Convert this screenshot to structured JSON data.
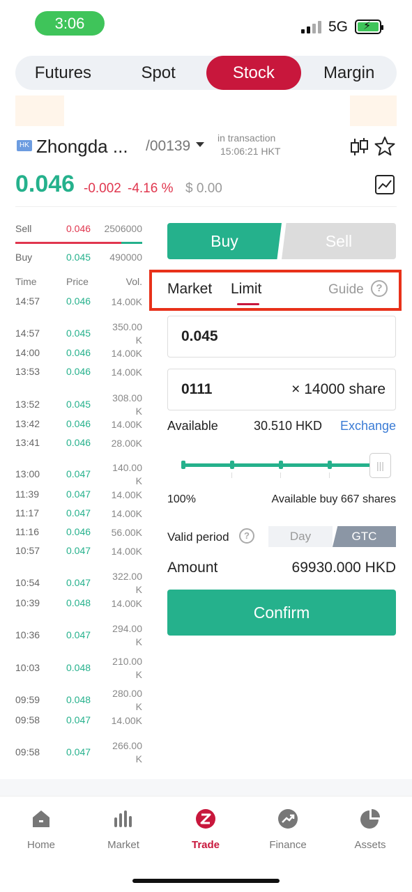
{
  "status_bar": {
    "time": "3:06",
    "network": "5G"
  },
  "top_tabs": [
    "Futures",
    "Spot",
    "Stock",
    "Margin"
  ],
  "stock": {
    "badge": "HK",
    "name": "Zhongda ...",
    "code": "/00139",
    "status": "in transaction",
    "status_time": "15:06:21 HKT",
    "last_price": "0.046",
    "change": "-0.002",
    "change_pct": "-4.16 %",
    "value": "$ 0.00"
  },
  "order_book": {
    "sell": {
      "label": "Sell",
      "price": "0.046",
      "volume": "2506000"
    },
    "buy": {
      "label": "Buy",
      "price": "0.045",
      "volume": "490000"
    }
  },
  "trades": {
    "headers": [
      "Time",
      "Price",
      "Vol."
    ],
    "rows": [
      {
        "time": "14:57",
        "price": "0.046",
        "vol": "14.00K"
      },
      {
        "time": "14:57",
        "price": "0.045",
        "vol": "350.00 K"
      },
      {
        "time": "14:00",
        "price": "0.046",
        "vol": "14.00K"
      },
      {
        "time": "13:53",
        "price": "0.046",
        "vol": "14.00K"
      },
      {
        "time": "13:52",
        "price": "0.045",
        "vol": "308.00 K"
      },
      {
        "time": "13:42",
        "price": "0.046",
        "vol": "14.00K"
      },
      {
        "time": "13:41",
        "price": "0.046",
        "vol": "28.00K"
      },
      {
        "time": "13:00",
        "price": "0.047",
        "vol": "140.00 K"
      },
      {
        "time": "11:39",
        "price": "0.047",
        "vol": "14.00K"
      },
      {
        "time": "11:17",
        "price": "0.047",
        "vol": "14.00K"
      },
      {
        "time": "11:16",
        "price": "0.046",
        "vol": "56.00K"
      },
      {
        "time": "10:57",
        "price": "0.047",
        "vol": "14.00K"
      },
      {
        "time": "10:54",
        "price": "0.047",
        "vol": "322.00 K"
      },
      {
        "time": "10:39",
        "price": "0.048",
        "vol": "14.00K"
      },
      {
        "time": "10:36",
        "price": "0.047",
        "vol": "294.00 K"
      },
      {
        "time": "10:03",
        "price": "0.048",
        "vol": "210.00 K"
      },
      {
        "time": "09:59",
        "price": "0.048",
        "vol": "280.00 K"
      },
      {
        "time": "09:58",
        "price": "0.047",
        "vol": "14.00K"
      },
      {
        "time": "09:58",
        "price": "0.047",
        "vol": "266.00 K"
      }
    ]
  },
  "trade_panel": {
    "buy_label": "Buy",
    "sell_label": "Sell",
    "order_types": {
      "market": "Market",
      "limit": "Limit",
      "guide": "Guide"
    },
    "price_value": "0.045",
    "qty_value": "0111",
    "qty_suffix": "× 14000  share",
    "available_label": "Available",
    "available_value": "30.510 HKD",
    "exchange_label": "Exchange",
    "slider_percent": "100%",
    "slider_level": 1.0,
    "available_buy": "Available buy 667 shares",
    "valid_period_label": "Valid period",
    "valid_options": [
      "Day",
      "GTC"
    ],
    "valid_selected": "GTC",
    "amount_label": "Amount",
    "amount_value": "69930.000  HKD",
    "confirm_label": "Confirm"
  },
  "colors": {
    "up_green": "#25b18c",
    "down_red": "#e0364e",
    "brand_red": "#c8173c",
    "link_blue": "#3a7bd5",
    "highlight": "#e8311a"
  },
  "bottom_nav": [
    {
      "label": "Home",
      "icon": "home-icon"
    },
    {
      "label": "Market",
      "icon": "market-icon"
    },
    {
      "label": "Trade",
      "icon": "trade-icon"
    },
    {
      "label": "Finance",
      "icon": "finance-icon"
    },
    {
      "label": "Assets",
      "icon": "assets-icon"
    }
  ]
}
